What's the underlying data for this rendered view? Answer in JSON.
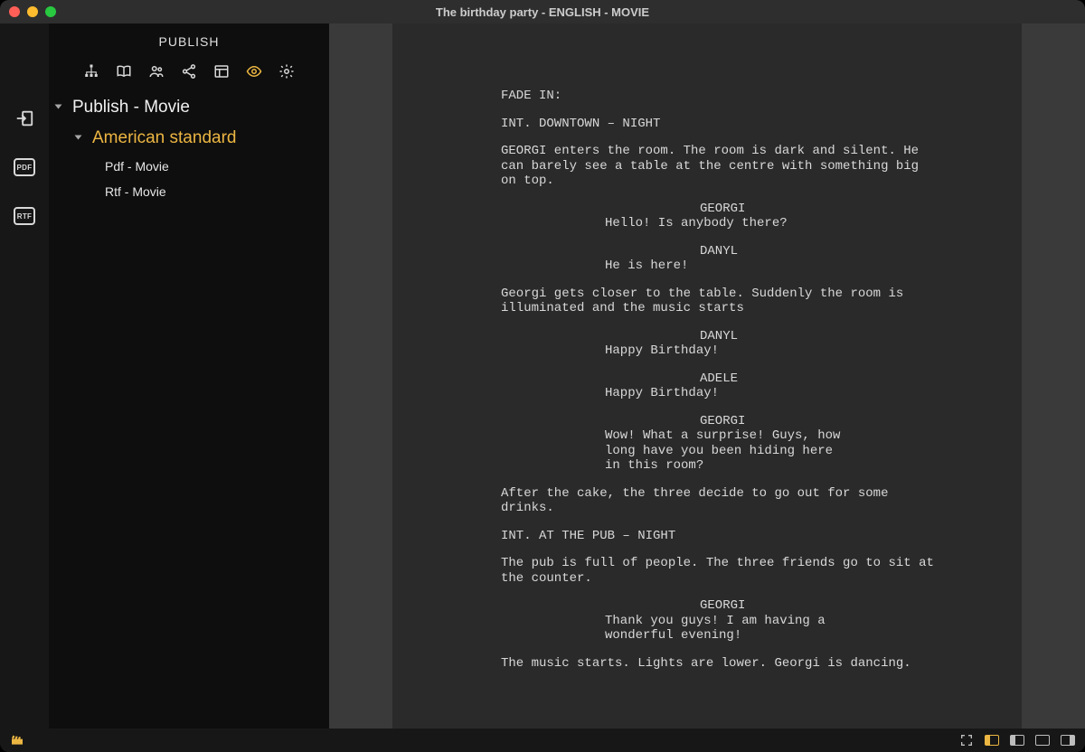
{
  "window": {
    "title": "The birthday party - ENGLISH - MOVIE"
  },
  "sidebar": {
    "title": "PUBLISH",
    "tree": {
      "root": "Publish - Movie",
      "group": "American standard",
      "items": [
        {
          "label": "Pdf - Movie",
          "icon": "PDF"
        },
        {
          "label": "Rtf - Movie",
          "icon": "RTF"
        }
      ]
    }
  },
  "toolbar_icons": [
    "hierarchy",
    "book",
    "people",
    "share",
    "layout",
    "eye",
    "gear"
  ],
  "script": {
    "fade_in": "FADE IN:",
    "scenes": [
      {
        "heading": "INT. DOWNTOWN – NIGHT",
        "blocks": [
          {
            "type": "action",
            "text": "GEORGI enters the room. The room is dark and silent. He can barely see a table at the centre with something big on top."
          },
          {
            "type": "char",
            "text": "GEORGI"
          },
          {
            "type": "dialog",
            "text": "Hello! Is anybody there?"
          },
          {
            "type": "char",
            "text": "DANYL"
          },
          {
            "type": "dialog",
            "text": "He is here!"
          },
          {
            "type": "action",
            "text": "Georgi gets closer to the table. Suddenly the room is illuminated and the music starts"
          },
          {
            "type": "char",
            "text": "DANYL"
          },
          {
            "type": "dialog",
            "text": "Happy Birthday!"
          },
          {
            "type": "char",
            "text": "ADELE"
          },
          {
            "type": "dialog",
            "text": "Happy Birthday!"
          },
          {
            "type": "char",
            "text": "GEORGI"
          },
          {
            "type": "dialog",
            "text": "Wow! What a surprise! Guys, how long have you been hiding here in this room?"
          },
          {
            "type": "action",
            "text": "After the cake, the three decide to go out for some drinks."
          }
        ]
      },
      {
        "heading": "INT. AT THE PUB – NIGHT",
        "blocks": [
          {
            "type": "action",
            "text": "The pub is full of people. The three friends go to sit at the counter."
          },
          {
            "type": "char",
            "text": "GEORGI"
          },
          {
            "type": "dialog",
            "text": "Thank you guys! I am having a wonderful evening!"
          },
          {
            "type": "action",
            "text": "The music starts. Lights are lower. Georgi is dancing."
          }
        ]
      }
    ]
  }
}
